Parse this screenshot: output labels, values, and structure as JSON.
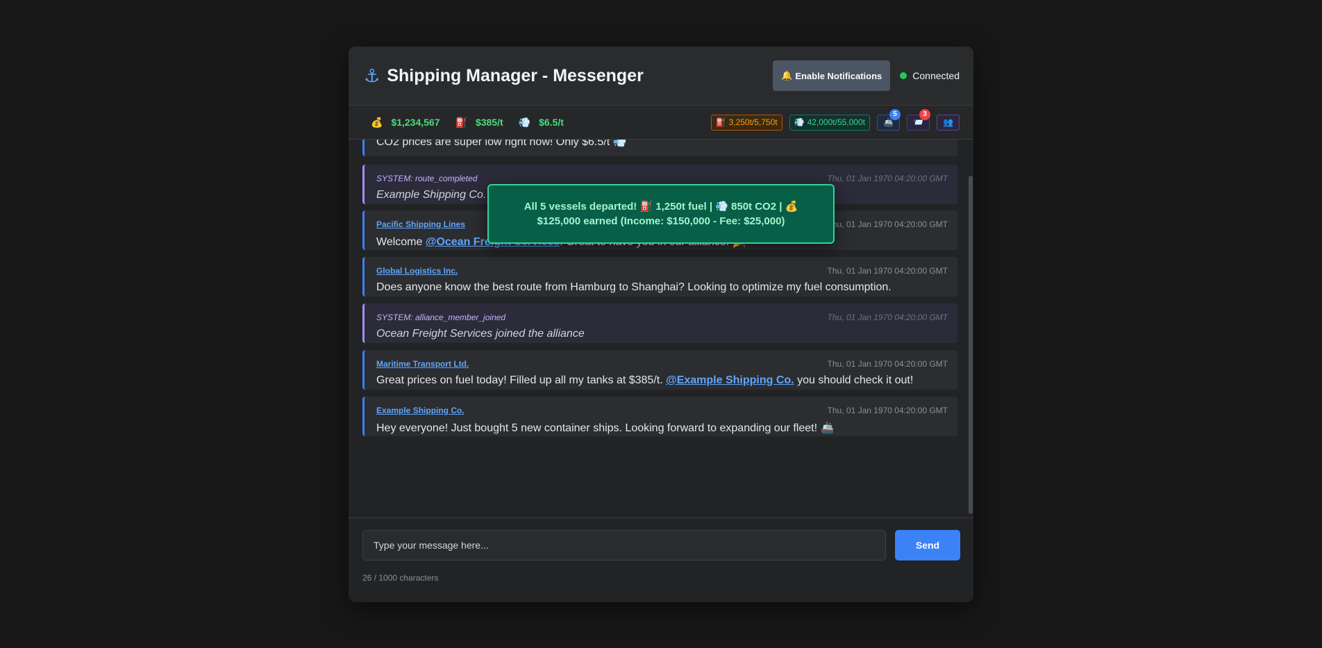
{
  "header": {
    "anchor_icon": "⚓",
    "title": "Shipping Manager - Messenger",
    "notifications_button": {
      "icon": "🔔",
      "label": "Enable Notifications"
    },
    "status": {
      "label": "Connected",
      "color": "#22c55e"
    }
  },
  "stats": {
    "cash": {
      "icon": "💰",
      "value": "$1,234,567"
    },
    "fuel_price": {
      "icon": "⛽",
      "value": "$385/t"
    },
    "co2_price": {
      "icon": "💨",
      "value": "$6.5/t"
    },
    "fuel_storage": {
      "icon": "⛽",
      "value": "3,250t/5,750t"
    },
    "co2_storage": {
      "icon": "💨",
      "value": "42,000t/55,000t"
    },
    "vessels_badge": {
      "icon": "🚢",
      "count": "5"
    },
    "messages_badge": {
      "icon": "📨",
      "count": "3"
    },
    "alliance_badge": {
      "icon": "👥"
    }
  },
  "messages": [
    {
      "type": "user",
      "author": "",
      "time": "",
      "text": "CO2 prices are super low right now! Only $6.5/t 💨"
    },
    {
      "type": "system",
      "author": "SYSTEM: route_completed",
      "time": "Thu, 01 Jan 1970 04:20:00 GMT",
      "text": "Example Shipping Co. c"
    },
    {
      "type": "user",
      "author": "Pacific Shipping Lines",
      "time": "Thu, 01 Jan 1970 04:20:00 GMT",
      "text_before": "Welcome ",
      "mention": "@Ocean Freight Services",
      "text_after": "! Great to have you in our alliance! 🎉"
    },
    {
      "type": "user",
      "author": "Global Logistics Inc.",
      "time": "Thu, 01 Jan 1970 04:20:00 GMT",
      "text": "Does anyone know the best route from Hamburg to Shanghai? Looking to optimize my fuel consumption."
    },
    {
      "type": "system",
      "author": "SYSTEM: alliance_member_joined",
      "time": "Thu, 01 Jan 1970 04:20:00 GMT",
      "text": "Ocean Freight Services joined the alliance"
    },
    {
      "type": "user",
      "author": "Maritime Transport Ltd.",
      "time": "Thu, 01 Jan 1970 04:20:00 GMT",
      "text_before": "Great prices on fuel today! Filled up all my tanks at $385/t. ",
      "mention": "@Example Shipping Co.",
      "text_after": " you should check it out!"
    },
    {
      "type": "user",
      "author": "Example Shipping Co.",
      "time": "Thu, 01 Jan 1970 04:20:00 GMT",
      "text": "Hey everyone! Just bought 5 new container ships. Looking forward to expanding our fleet! 🚢"
    }
  ],
  "toast": {
    "line1": "All 5 vessels departed! ⛽ 1,250t fuel | 💨 850t CO2 | 💰",
    "line2": "$125,000 earned (Income: $150,000 - Fee: $25,000)"
  },
  "composer": {
    "placeholder": "Type your message here...",
    "send_label": "Send",
    "char_count": "26 / 1000 characters"
  },
  "colors": {
    "accent": "#3b82f6",
    "positive": "#4ade80",
    "system": "#a78bfa",
    "toast_bg": "#065f46"
  }
}
